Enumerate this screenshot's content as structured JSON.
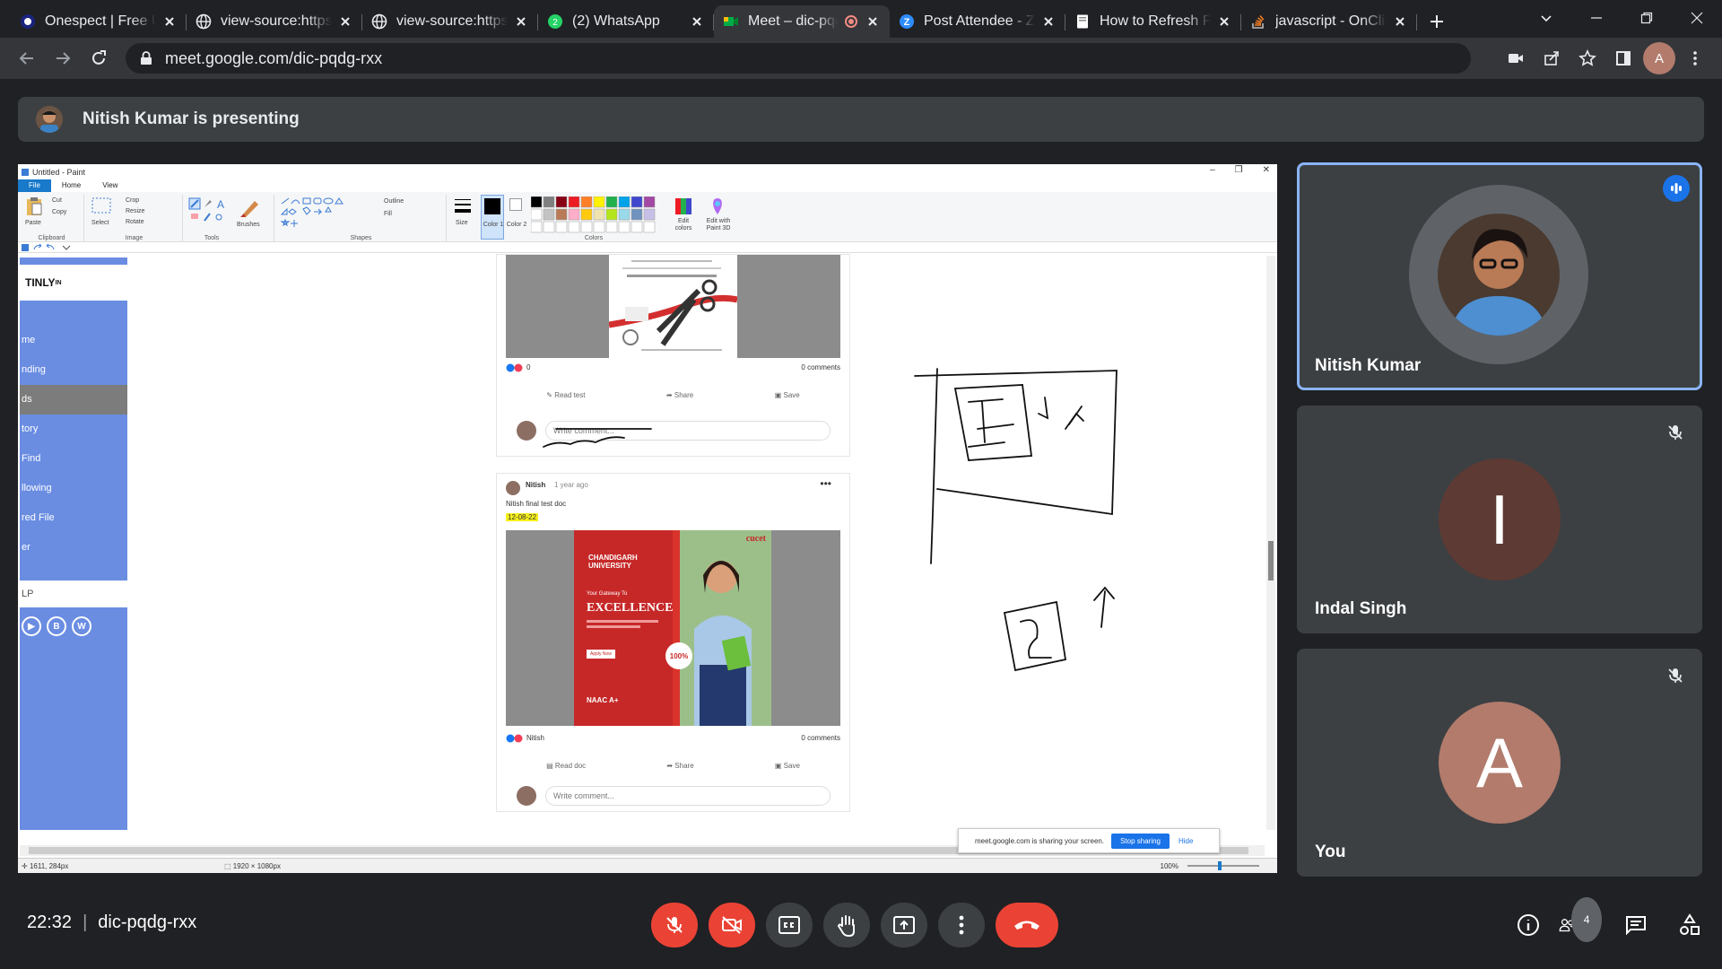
{
  "browser": {
    "tabs": [
      {
        "title": "Onespect | Free U",
        "icon": "onespect-icon"
      },
      {
        "title": "view-source:https",
        "icon": "globe-icon"
      },
      {
        "title": "view-source:https",
        "icon": "globe-icon"
      },
      {
        "title": "(2) WhatsApp",
        "icon": "whatsapp-icon"
      },
      {
        "title": "Meet – dic-pqdg-rxx",
        "icon": "meet-icon",
        "active": true
      },
      {
        "title": "Post Attendee - Z",
        "icon": "zoom-icon"
      },
      {
        "title": "How to Refresh P",
        "icon": "page-icon"
      },
      {
        "title": "javascript - OnClic",
        "icon": "stackoverflow-icon"
      }
    ],
    "url": "meet.google.com/dic-pqdg-rxx",
    "profile_initial": "A"
  },
  "meet": {
    "presenting_text": "Nitish Kumar is presenting",
    "time": "22:32",
    "meeting_code": "dic-pqdg-rxx",
    "participant_count": "4",
    "participants": [
      {
        "name": "Nitish Kumar",
        "speaking": true
      },
      {
        "name": "Indal Singh",
        "initial": "I",
        "color": "#5d3a33",
        "muted": true
      },
      {
        "name": "You",
        "initial": "A",
        "color": "#b27b6c",
        "muted": true
      }
    ]
  },
  "paint": {
    "title": "Untitled - Paint",
    "menu": [
      "File",
      "Home",
      "View"
    ],
    "groups": [
      "Clipboard",
      "Image",
      "Tools",
      "Shapes",
      "Colors"
    ],
    "tool_labels": {
      "paste": "Paste",
      "cut": "Cut",
      "copy": "Copy",
      "select": "Select",
      "crop": "Crop",
      "resize": "Resize",
      "rotate": "Rotate",
      "brushes": "Brushes",
      "outline": "Outline",
      "fill": "Fill",
      "size": "Size",
      "color1": "Color 1",
      "color2": "Color 2",
      "edit_colors": "Edit colors",
      "edit_3d": "Edit with Paint 3D"
    },
    "status_pos": "1611, 284px",
    "status_size": "1920 × 1080px",
    "zoom": "100%",
    "sidebar": {
      "logo": "TINLY",
      "items": [
        "me",
        "nding",
        "ds",
        "tory",
        "Find",
        "llowing",
        "red File",
        "er"
      ],
      "selected": 2,
      "lp": "LP"
    },
    "post1": {
      "likes": "0",
      "comments": "0 comments",
      "read": "Read test",
      "share": "Share",
      "save": "Save",
      "comment_placeholder": "Write comment..."
    },
    "post2": {
      "author": "Nitish",
      "time": "1 year ago",
      "body": "Nitish final test doc",
      "date": "12-08-22",
      "reactor": "Nitish",
      "comments": "0 comments",
      "read": "Read doc",
      "share": "Share",
      "save": "Save",
      "comment_placeholder": "Write comment...",
      "flyer": {
        "brand": "CHANDIGARH UNIVERSITY",
        "tagline": "Your Gateway To",
        "headline": "EXCELLENCE",
        "badge": "100%",
        "cta": "Apply Now",
        "naac": "NAAC A+",
        "corner": "cucet"
      }
    },
    "share_notice": {
      "text": "meet.google.com is sharing your screen.",
      "stop": "Stop sharing",
      "hide": "Hide"
    }
  }
}
